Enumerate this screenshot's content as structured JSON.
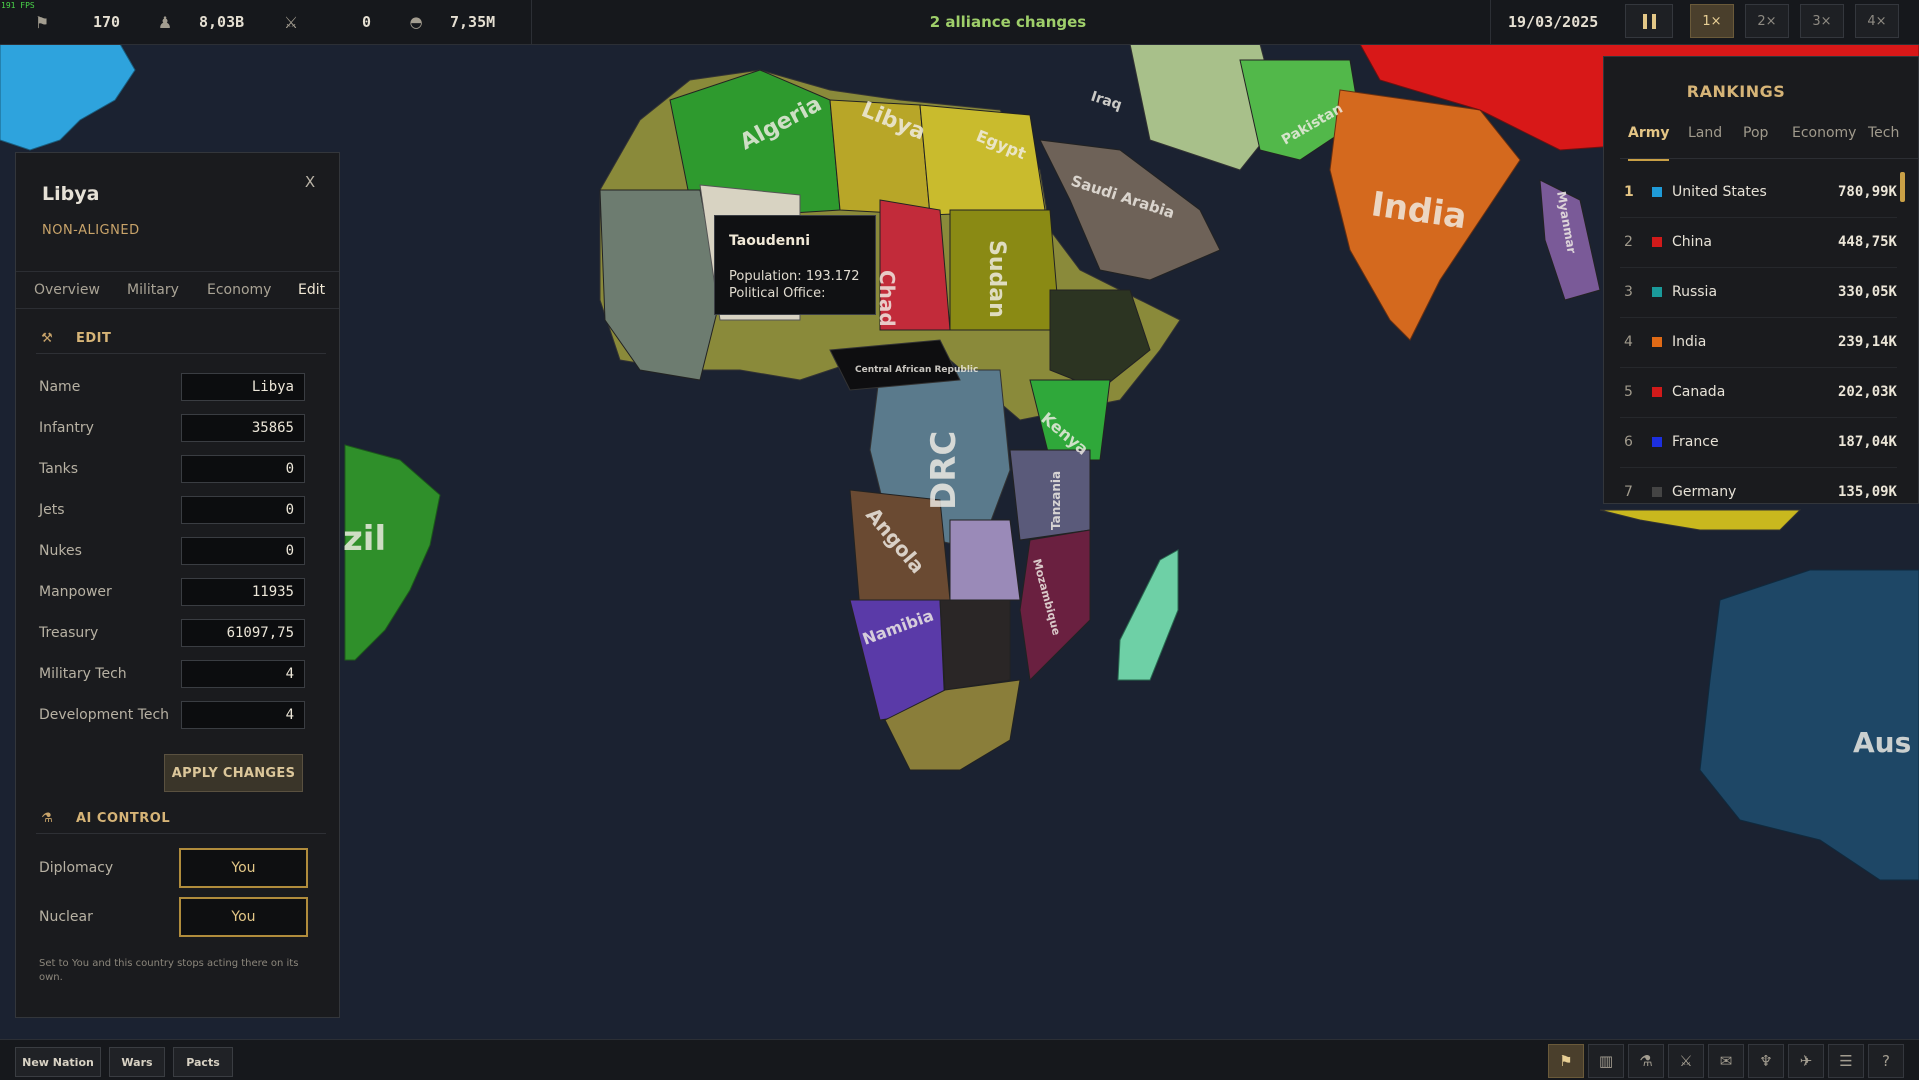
{
  "fps": "191 FPS",
  "topbar": {
    "stats": [
      {
        "icon": "flag-icon",
        "value": "170"
      },
      {
        "icon": "population-icon",
        "value": "8,03B"
      },
      {
        "icon": "crossed-swords-icon",
        "value": "0"
      },
      {
        "icon": "helmet-icon",
        "value": "7,35M"
      }
    ],
    "alliance_text": "2 alliance changes",
    "date": "19/03/2025",
    "speeds": [
      "1×",
      "2×",
      "3×",
      "4×"
    ],
    "active_speed": "1×"
  },
  "panel": {
    "country": "Libya",
    "status": "NON-ALIGNED",
    "close": "X",
    "tabs": [
      "Overview",
      "Military",
      "Economy",
      "Edit"
    ],
    "active_tab": "Edit",
    "edit_heading": "EDIT",
    "fields": [
      {
        "label": "Name",
        "value": "Libya"
      },
      {
        "label": "Infantry",
        "value": "35865"
      },
      {
        "label": "Tanks",
        "value": "0"
      },
      {
        "label": "Jets",
        "value": "0"
      },
      {
        "label": "Nukes",
        "value": "0"
      },
      {
        "label": "Manpower",
        "value": "11935"
      },
      {
        "label": "Treasury",
        "value": "61097,75"
      },
      {
        "label": "Military Tech",
        "value": "4"
      },
      {
        "label": "Development Tech",
        "value": "4"
      }
    ],
    "apply_label": "APPLY CHANGES",
    "ai_heading": "AI CONTROL",
    "ai_rows": [
      {
        "label": "Diplomacy",
        "value": "You"
      },
      {
        "label": "Nuclear",
        "value": "You"
      }
    ],
    "note": "Set to You and this country stops acting there on its own."
  },
  "tooltip": {
    "title": "Taoudenni",
    "population": "Population: 193.172",
    "office": "Political Office:"
  },
  "rankings": {
    "title": "RANKINGS",
    "tabs": [
      "Army",
      "Land",
      "Pop",
      "Economy",
      "Tech"
    ],
    "active_tab": "Army",
    "rows": [
      {
        "rank": "1",
        "name": "United States",
        "value": "780,99K",
        "color": "#1f9bd8"
      },
      {
        "rank": "2",
        "name": "China",
        "value": "448,75K",
        "color": "#d11a1a"
      },
      {
        "rank": "3",
        "name": "Russia",
        "value": "330,05K",
        "color": "#1a9a9a"
      },
      {
        "rank": "4",
        "name": "India",
        "value": "239,14K",
        "color": "#e06a16"
      },
      {
        "rank": "5",
        "name": "Canada",
        "value": "202,03K",
        "color": "#d11a1a"
      },
      {
        "rank": "6",
        "name": "France",
        "value": "187,04K",
        "color": "#1c2fe0"
      },
      {
        "rank": "7",
        "name": "Germany",
        "value": "135,09K",
        "color": "#444444"
      }
    ]
  },
  "bottombar": {
    "buttons": [
      "New Nation",
      "Wars",
      "Pacts"
    ],
    "icons": [
      "flag-icon",
      "factory-icon",
      "flask-icon",
      "crossed-swords-icon",
      "scroll-icon",
      "eagle-icon",
      "jet-icon",
      "menu-icon",
      "help-icon"
    ],
    "help_glyph": "?"
  },
  "map": {
    "labels": [
      "Algeria",
      "Libya",
      "Egypt",
      "Chad",
      "Sudan",
      "Saudi Arabia",
      "Iraq",
      "Pakistan",
      "India",
      "Myanmar",
      "DRC",
      "Angola",
      "Namibia",
      "Kenya",
      "Tanzania",
      "Mozambique",
      "Central African Republic",
      "zil",
      "Aus"
    ]
  }
}
